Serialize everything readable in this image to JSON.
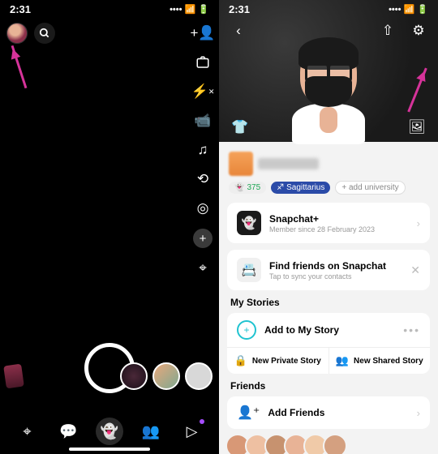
{
  "status": {
    "time": "2:31"
  },
  "right_toolbar_icons": [
    "add-friend",
    "flip-camera",
    "flash",
    "video",
    "music",
    "rotate",
    "dual-camera",
    "plus",
    "scan"
  ],
  "nav": [
    "map",
    "chat",
    "camera",
    "stories",
    "spotlight"
  ],
  "profile": {
    "score_icon": "👻",
    "score": "375",
    "zodiac_icon": "♐︎",
    "zodiac": "Sagittarius",
    "add_uni": "+ add university"
  },
  "cards": {
    "plus_title": "Snapchat+",
    "plus_sub": "Member since 28 February 2023",
    "find_title": "Find friends on Snapchat",
    "find_sub": "Tap to sync your contacts"
  },
  "sections": {
    "stories": "My Stories",
    "add_story": "Add to My Story",
    "private": "New Private Story",
    "shared": "New Shared Story",
    "friends": "Friends",
    "add_friends": "Add Friends"
  }
}
